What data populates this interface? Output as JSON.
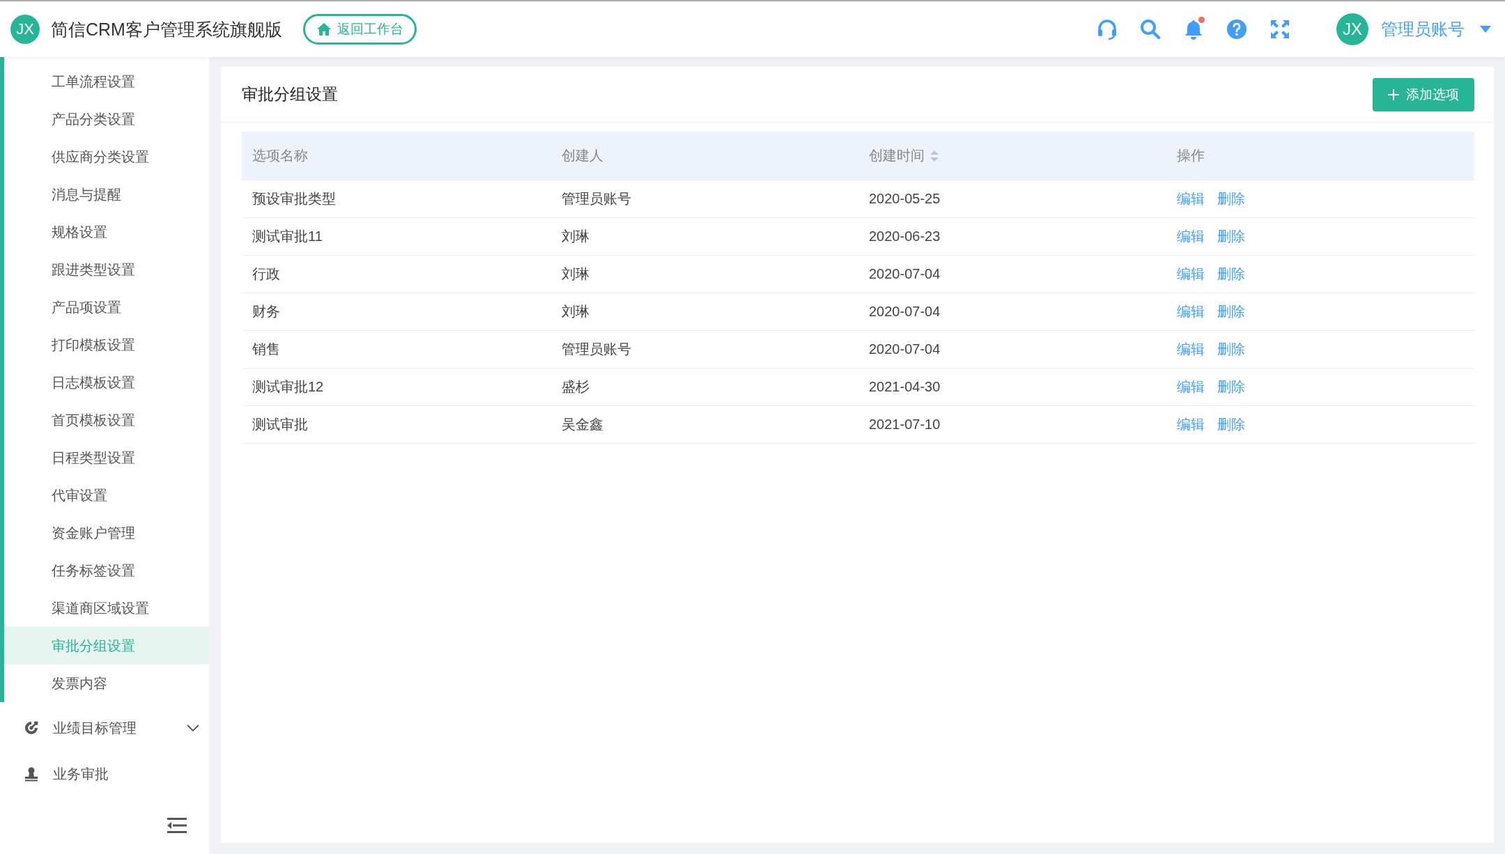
{
  "header": {
    "logo": "JX",
    "title": "简信CRM客户管理系统旗舰版",
    "home_button": "返回工作台",
    "notification_dot": true,
    "avatar": "JX",
    "user": "管理员账号"
  },
  "sidebar": {
    "items": [
      {
        "label": "工单流程设置",
        "selected": false
      },
      {
        "label": "产品分类设置",
        "selected": false
      },
      {
        "label": "供应商分类设置",
        "selected": false
      },
      {
        "label": "消息与提醒",
        "selected": false
      },
      {
        "label": "规格设置",
        "selected": false
      },
      {
        "label": "跟进类型设置",
        "selected": false
      },
      {
        "label": "产品项设置",
        "selected": false
      },
      {
        "label": "打印模板设置",
        "selected": false
      },
      {
        "label": "日志模板设置",
        "selected": false
      },
      {
        "label": "首页模板设置",
        "selected": false
      },
      {
        "label": "日程类型设置",
        "selected": false
      },
      {
        "label": "代审设置",
        "selected": false
      },
      {
        "label": "资金账户管理",
        "selected": false
      },
      {
        "label": "任务标签设置",
        "selected": false
      },
      {
        "label": "渠道商区域设置",
        "selected": false
      },
      {
        "label": "审批分组设置",
        "selected": true
      },
      {
        "label": "发票内容",
        "selected": false
      }
    ],
    "groups": [
      {
        "label": "业绩目标管理",
        "kind": "submenu",
        "expanded": false
      },
      {
        "label": "业务审批",
        "kind": "link"
      }
    ]
  },
  "panel": {
    "title": "审批分组设置",
    "add_button": "添加选项",
    "columns": [
      {
        "label": "选项名称",
        "sortable": false
      },
      {
        "label": "创建人",
        "sortable": false
      },
      {
        "label": "创建时间",
        "sortable": true
      },
      {
        "label": "操作",
        "sortable": false
      }
    ],
    "rows": [
      {
        "cells": [
          "预设审批类型",
          "管理员账号",
          "2020-05-25"
        ],
        "actions": [
          "编辑",
          "删除"
        ]
      },
      {
        "cells": [
          "测试审批11",
          "刘琳",
          "2020-06-23"
        ],
        "actions": [
          "编辑",
          "删除"
        ]
      },
      {
        "cells": [
          "行政",
          "刘琳",
          "2020-07-04"
        ],
        "actions": [
          "编辑",
          "删除"
        ]
      },
      {
        "cells": [
          "财务",
          "刘琳",
          "2020-07-04"
        ],
        "actions": [
          "编辑",
          "删除"
        ]
      },
      {
        "cells": [
          "销售",
          "管理员账号",
          "2020-07-04"
        ],
        "actions": [
          "编辑",
          "删除"
        ]
      },
      {
        "cells": [
          "测试审批12",
          "盛杉",
          "2021-04-30"
        ],
        "actions": [
          "编辑",
          "删除"
        ]
      },
      {
        "cells": [
          "测试审批",
          "吴金鑫",
          "2021-07-10"
        ],
        "actions": [
          "编辑",
          "删除"
        ]
      }
    ]
  }
}
